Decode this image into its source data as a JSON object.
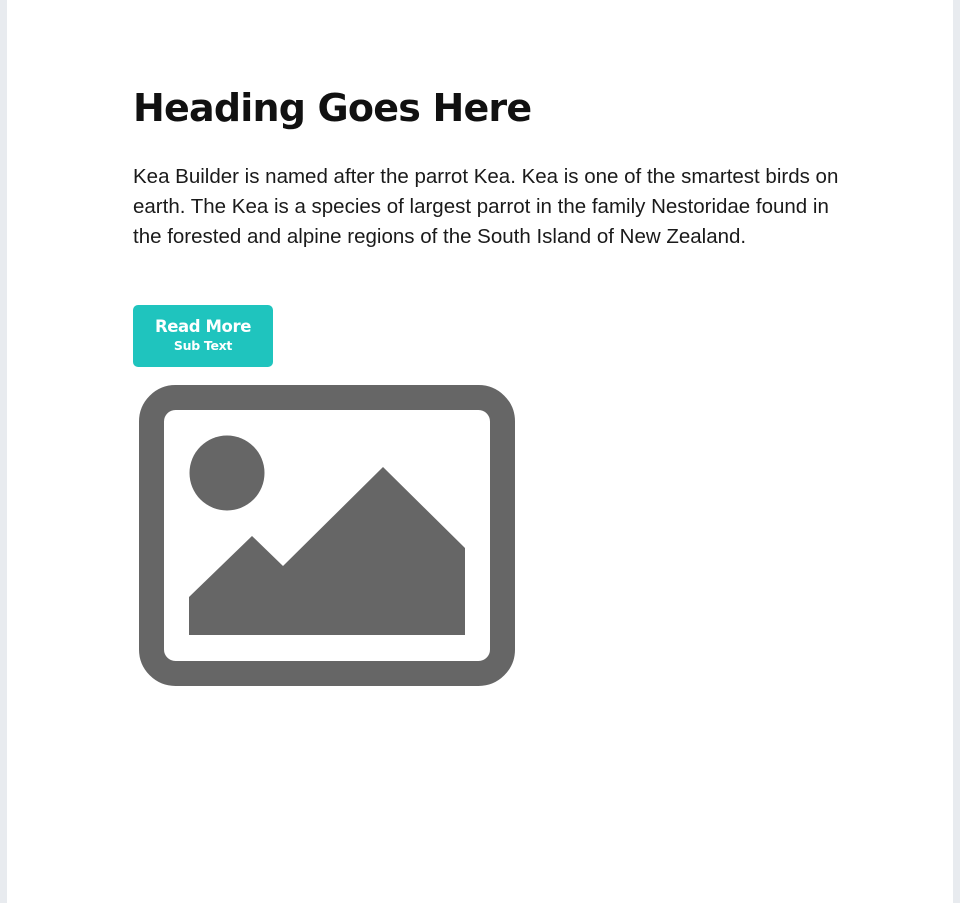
{
  "section": {
    "heading": "Heading Goes Here",
    "body": "Kea Builder is named after the parrot Kea. Kea is one of the smartest birds on earth. The Kea is a species of largest parrot in the family Nestoridae found in the forested and alpine regions of the South Island of New Zealand.",
    "button": {
      "label": "Read More",
      "sub_text": "Sub Text",
      "color": "#1fc4be"
    },
    "image": {
      "icon": "image-placeholder-icon",
      "color": "#666666"
    }
  },
  "colors": {
    "page_background": "#e8ebef",
    "canvas_background": "#ffffff",
    "text": "#111111"
  }
}
